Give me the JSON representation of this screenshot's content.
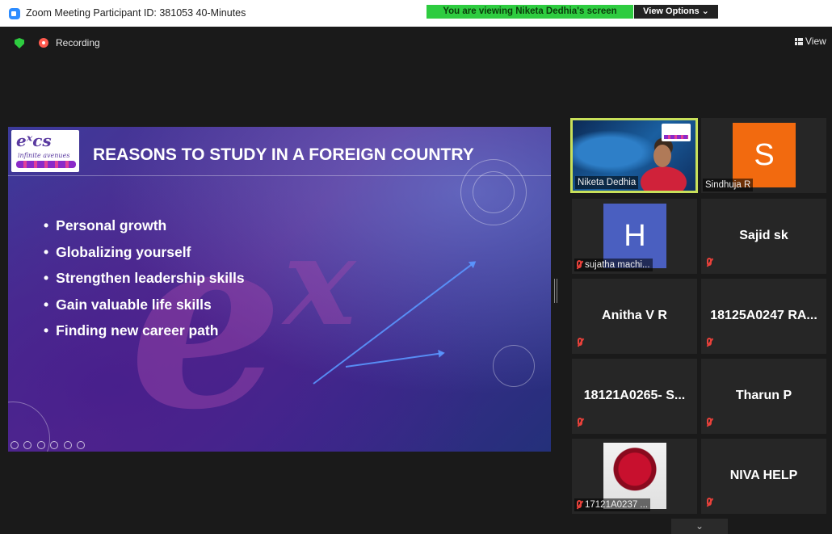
{
  "window": {
    "title": "Zoom Meeting Participant ID: 381053   40-Minutes"
  },
  "share_banner": {
    "text": "You are viewing Niketa Dedhia's screen",
    "view_options_label": "View Options ⌄"
  },
  "toolbar": {
    "recording_label": "Recording",
    "view_label": "View"
  },
  "slide": {
    "title": "REASONS TO STUDY IN A FOREIGN COUNTRY",
    "logo_text": "eˣcs",
    "logo_subtitle": "infinite avenues",
    "bullets": [
      "Personal growth",
      "Globalizing yourself",
      "Strengthen leadership skills",
      "Gain valuable life skills",
      "Finding new career path"
    ]
  },
  "participants": {
    "niketa": {
      "name": "Niketa Dedhia"
    },
    "sindhuja": {
      "name": "Sindhuja R",
      "initial": "S",
      "avatar_color": "#f26a0f"
    },
    "sujatha": {
      "name": "sujatha machi...",
      "initial": "H",
      "avatar_color": "#4a5fc0"
    },
    "sajid": {
      "name": "Sajid sk"
    },
    "anitha": {
      "name": "Anitha V R"
    },
    "p18125": {
      "name": "18125A0247  RA..."
    },
    "p18121": {
      "name": "18121A0265- S..."
    },
    "tharun": {
      "name": "Tharun P"
    },
    "p17121": {
      "name": "17121A0237 ..."
    },
    "niva": {
      "name": "NIVA HELP"
    }
  },
  "colors": {
    "share_banner": "#2ecc40",
    "muted_mic": "#e8413a",
    "active_speaker_border": "#c8e05a",
    "meeting_background": "#1a1a1a"
  }
}
